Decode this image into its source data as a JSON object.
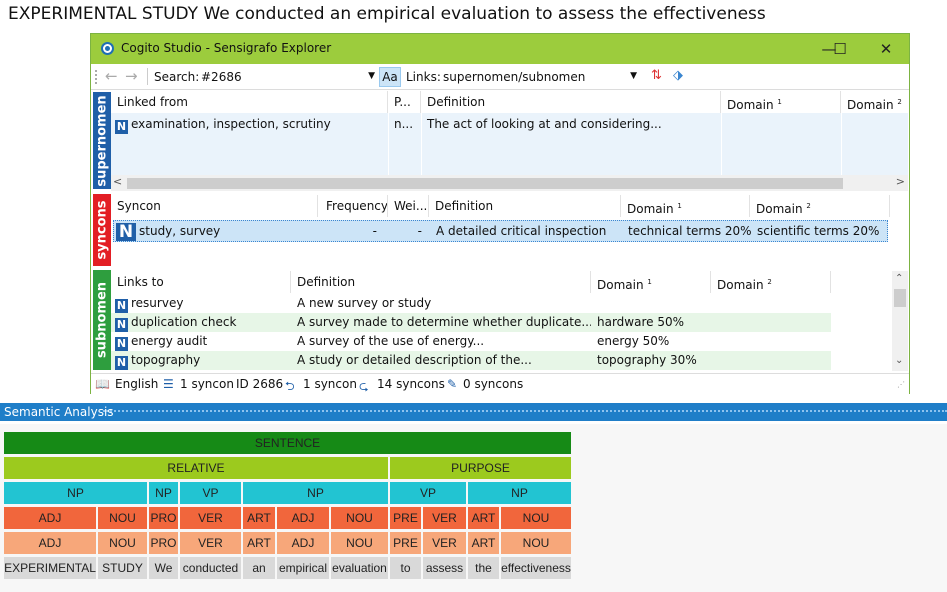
{
  "doc_text": "EXPERIMENTAL STUDY We conducted an empirical evaluation to assess the effectiveness",
  "window": {
    "title": "Cogito Studio - Sensigrafo Explorer",
    "minimize": "—",
    "maximize": "☐",
    "close": "✕"
  },
  "toolbar": {
    "back": "←",
    "forward": "→",
    "search_label": "Search:",
    "search_value": "#2686",
    "aa_label": "Aa",
    "links_label": "Links:",
    "links_value": "supernomen/subnomen"
  },
  "supernomen": {
    "side_label": "supernomen",
    "side_color": "#1f5fa8",
    "headers": [
      "Linked from",
      "P...",
      "Definition",
      "Domain",
      "Domain"
    ],
    "rows": [
      {
        "term": "examination, inspection, scrutiny",
        "p": "n...",
        "definition": "The act of looking at and considering...",
        "domain1": "",
        "domain2": ""
      }
    ],
    "scroll_left": "<",
    "scroll_right": ">"
  },
  "syncons": {
    "side_label": "syncons",
    "side_color": "#e31e24",
    "headers": [
      "Syncon",
      "Frequency",
      "Wei...",
      "Definition",
      "Domain",
      "Domain"
    ],
    "rows": [
      {
        "term": "study, survey",
        "frequency": "-",
        "weight": "-",
        "definition": "A detailed critical inspection",
        "domain1": "technical terms  20%",
        "domain2": "scientific terms  20%"
      }
    ]
  },
  "subnomen": {
    "side_label": "subnomen",
    "side_color": "#2e9e3e",
    "headers": [
      "Links to",
      "Definition",
      "Domain",
      "Domain"
    ],
    "rows": [
      {
        "term": "resurvey",
        "definition": "A new survey or study",
        "domain1": "",
        "domain2": ""
      },
      {
        "term": "duplication check",
        "definition": "A survey made to determine whether duplicate...",
        "domain1": "hardware  50%",
        "domain2": ""
      },
      {
        "term": "energy audit",
        "definition": "A survey of the use of energy...",
        "domain1": "energy  50%",
        "domain2": ""
      },
      {
        "term": "topography",
        "definition": "A study or detailed description of the...",
        "domain1": "topography  30%",
        "domain2": ""
      }
    ]
  },
  "badge_letter": "N",
  "domain_sup1": "1",
  "domain_sup2": "2",
  "statusbar": {
    "language": "English",
    "syncon_count": "1 syncon",
    "id": "ID 2686",
    "links_in": "1 syncon",
    "links_out": "14 syncons",
    "pinned": "0 syncons"
  },
  "semantic_analysis": {
    "title": "Semantic Analysis",
    "sentence_label": "SENTENCE",
    "phrases": [
      "RELATIVE",
      "PURPOSE"
    ],
    "chunks": [
      "NP",
      "NP",
      "VP",
      "NP",
      "VP",
      "NP"
    ],
    "pos1": [
      "ADJ",
      "NOU",
      "PRO",
      "VER",
      "ART",
      "ADJ",
      "NOU",
      "PRE",
      "VER",
      "ART",
      "NOU"
    ],
    "pos2": [
      "ADJ",
      "NOU",
      "PRO",
      "VER",
      "ART",
      "ADJ",
      "NOU",
      "PRE",
      "VER",
      "ART",
      "NOU"
    ],
    "words": [
      "EXPERIMENTAL",
      "STUDY",
      "We",
      "conducted",
      "an",
      "empirical",
      "evaluation",
      "to",
      "assess",
      "the",
      "effectiveness"
    ]
  }
}
